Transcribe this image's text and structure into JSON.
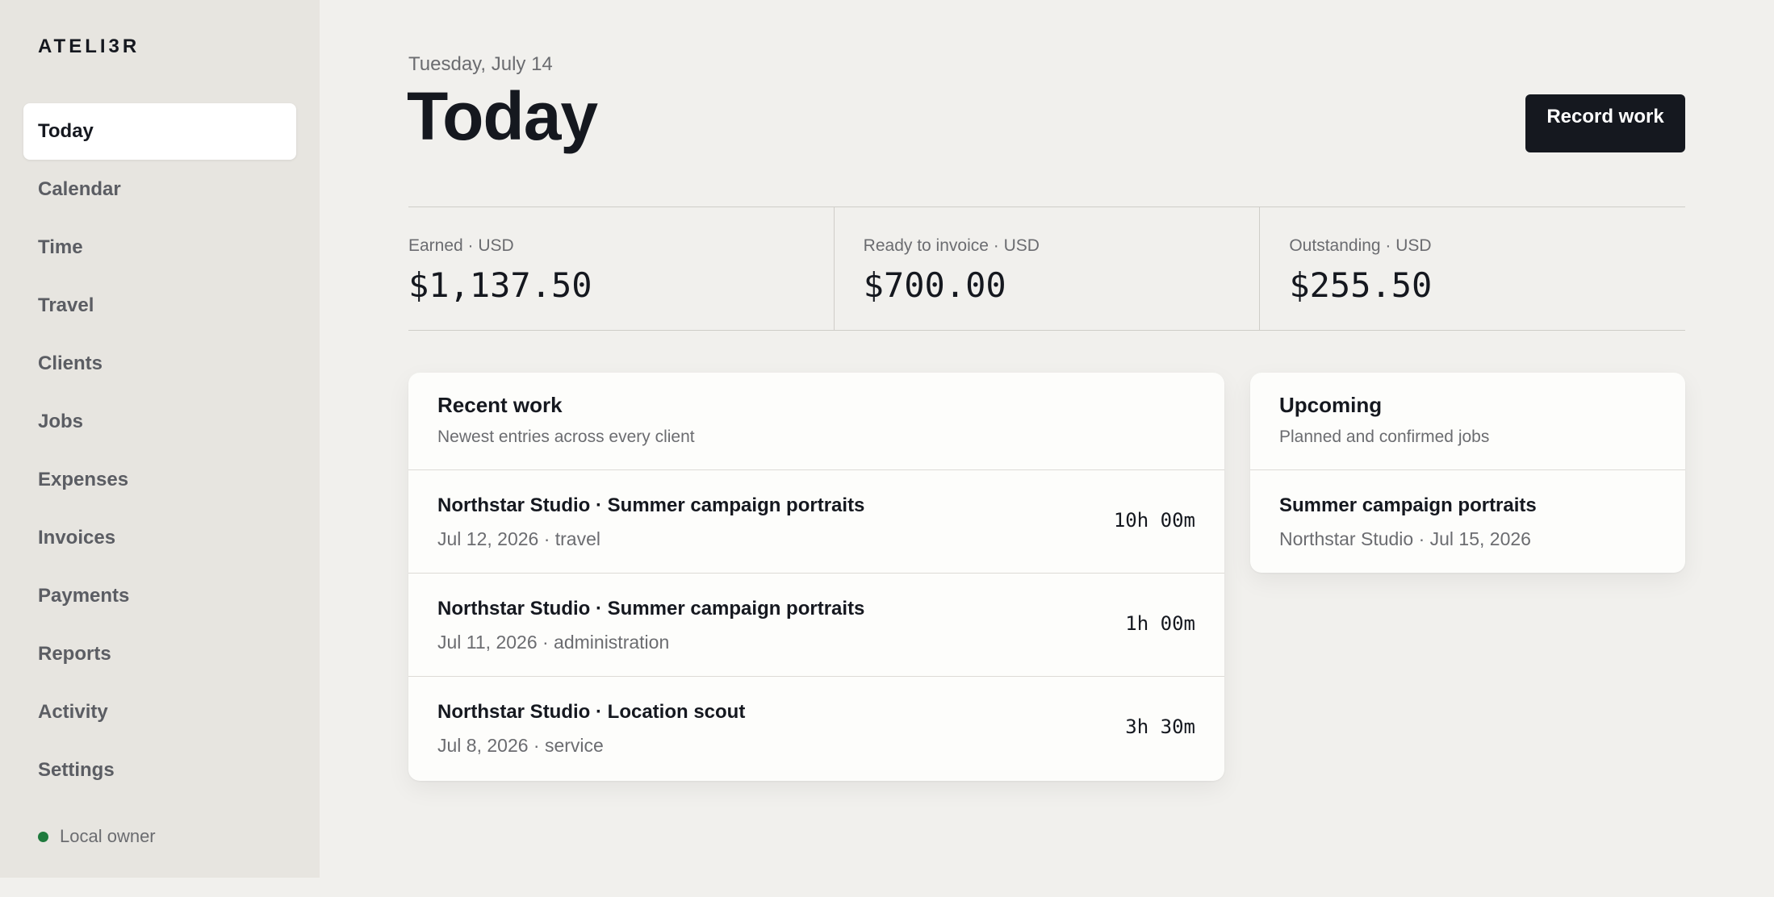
{
  "app": {
    "brand": "ATELI3R"
  },
  "sidebar": {
    "items": [
      {
        "label": "Today",
        "active": true
      },
      {
        "label": "Calendar"
      },
      {
        "label": "Time"
      },
      {
        "label": "Travel"
      },
      {
        "label": "Clients"
      },
      {
        "label": "Jobs"
      },
      {
        "label": "Expenses"
      },
      {
        "label": "Invoices"
      },
      {
        "label": "Payments"
      },
      {
        "label": "Reports"
      },
      {
        "label": "Activity"
      },
      {
        "label": "Settings"
      }
    ],
    "owner": {
      "label": "Local owner",
      "status_color": "#1f7a3d"
    }
  },
  "header": {
    "date": "Tuesday, July 14",
    "title": "Today",
    "record_button": "Record work"
  },
  "stats": [
    {
      "label": "Earned · USD",
      "value": "$1,137.50"
    },
    {
      "label": "Ready to invoice · USD",
      "value": "$700.00"
    },
    {
      "label": "Outstanding · USD",
      "value": "$255.50"
    }
  ],
  "recent": {
    "title": "Recent work",
    "subtitle": "Newest entries across every client",
    "rows": [
      {
        "title": "Northstar Studio · Summer campaign portraits",
        "meta": "Jul 12, 2026 · travel",
        "duration": "10h 00m"
      },
      {
        "title": "Northstar Studio · Summer campaign portraits",
        "meta": "Jul 11, 2026 · administration",
        "duration": "1h 00m"
      },
      {
        "title": "Northstar Studio · Location scout",
        "meta": "Jul 8, 2026 · service",
        "duration": "3h 30m"
      }
    ]
  },
  "upcoming": {
    "title": "Upcoming",
    "subtitle": "Planned and confirmed jobs",
    "rows": [
      {
        "title": "Summer campaign portraits",
        "meta": "Northstar Studio · Jul 15, 2026"
      }
    ]
  },
  "colors": {
    "accent": "#15181f",
    "background": "#f1f0ed",
    "sidebar": "#e7e5e0",
    "card": "#fdfdfb"
  }
}
